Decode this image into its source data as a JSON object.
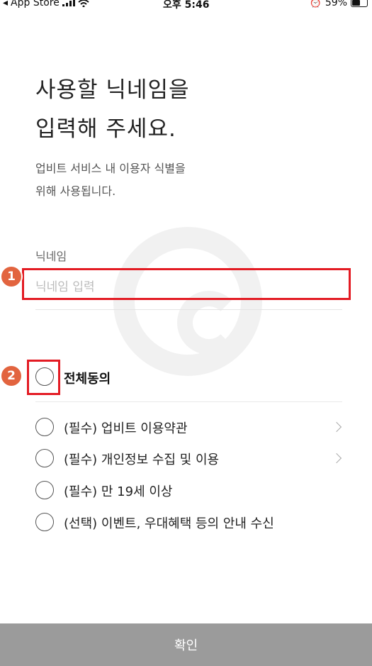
{
  "status_bar": {
    "back_app": "App Store",
    "time": "오후 5:46",
    "battery": "59%"
  },
  "page": {
    "title_line1": "사용할 닉네임을",
    "title_line2": "입력해 주세요.",
    "desc_line1": "업비트 서비스 내 이용자 식별을",
    "desc_line2": "위해 사용됩니다."
  },
  "nickname": {
    "label": "닉네임",
    "placeholder": "닉네임 입력",
    "value": ""
  },
  "annotations": {
    "badge1": "1",
    "badge2": "2"
  },
  "agreements": {
    "all_label": "전체동의",
    "items": [
      {
        "label": "(필수) 업비트 이용약관",
        "has_arrow": true
      },
      {
        "label": "(필수) 개인정보 수집 및 이용",
        "has_arrow": true
      },
      {
        "label": "(필수) 만 19세 이상",
        "has_arrow": false
      },
      {
        "label": "(선택) 이벤트, 우대혜택 등의 안내 수신",
        "has_arrow": false
      }
    ]
  },
  "confirm_label": "확인",
  "colors": {
    "highlight": "#e31b23",
    "badge": "#e2643f",
    "button_disabled": "#9b9b9b"
  }
}
